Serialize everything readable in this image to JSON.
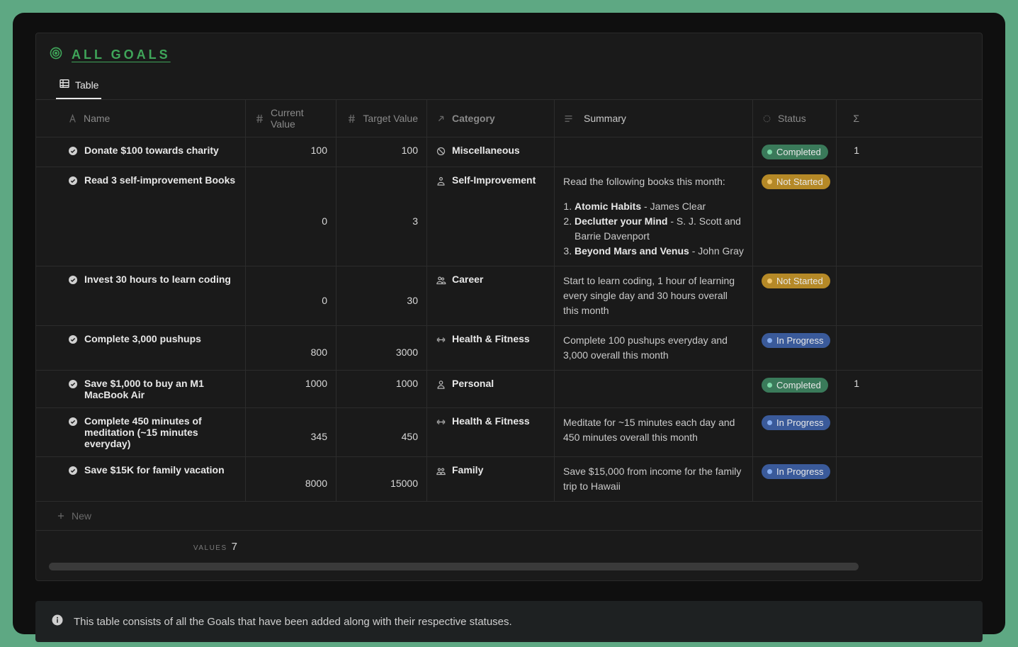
{
  "title": "ALL GOALS",
  "tab_label": "Table",
  "columns": {
    "name": "Name",
    "current": "Current Value",
    "target": "Target Value",
    "category": "Category",
    "summary": "Summary",
    "status": "Status",
    "sigma": "Σ"
  },
  "rows": [
    {
      "name": "Donate $100 towards charity",
      "current": "100",
      "target": "100",
      "category": "Miscellaneous",
      "category_icon": "ban",
      "summary_intro": "",
      "summary_items": [],
      "status": "Completed",
      "status_class": "completed",
      "sigma": "1"
    },
    {
      "name": "Read 3 self-improvement Books",
      "current": "0",
      "target": "3",
      "category": "Self-Improvement",
      "category_icon": "person-star",
      "summary_intro": "Read the following books this month:",
      "summary_items": [
        {
          "bold": "Atomic Habits",
          "rest": " - James Clear"
        },
        {
          "bold": "Declutter your Mind",
          "rest": " - S. J. Scott and Barrie Davenport"
        },
        {
          "bold": "Beyond Mars and Venus",
          "rest": " - John Gray"
        }
      ],
      "status": "Not Started",
      "status_class": "notstarted",
      "sigma": ""
    },
    {
      "name": "Invest 30 hours to learn coding",
      "current": "0",
      "target": "30",
      "category": "Career",
      "category_icon": "people",
      "summary_intro": "Start to learn coding, 1 hour of learning every single day and 30 hours overall this month",
      "summary_items": [],
      "status": "Not Started",
      "status_class": "notstarted",
      "sigma": ""
    },
    {
      "name": "Complete 3,000 pushups",
      "current": "800",
      "target": "3000",
      "category": "Health & Fitness",
      "category_icon": "dumbbell",
      "summary_intro": "Complete 100 pushups everyday and 3,000 overall this month",
      "summary_items": [],
      "status": "In Progress",
      "status_class": "inprogress",
      "sigma": ""
    },
    {
      "name": "Save $1,000 to buy an M1 MacBook Air",
      "current": "1000",
      "target": "1000",
      "category": "Personal",
      "category_icon": "person",
      "summary_intro": "",
      "summary_items": [],
      "status": "Completed",
      "status_class": "completed",
      "sigma": "1"
    },
    {
      "name": "Complete 450 minutes of meditation (~15 minutes everyday)",
      "current": "345",
      "target": "450",
      "category": "Health & Fitness",
      "category_icon": "dumbbell",
      "summary_intro": "Meditate for ~15 minutes each day and 450 minutes overall this month",
      "summary_items": [],
      "status": "In Progress",
      "status_class": "inprogress",
      "sigma": ""
    },
    {
      "name": "Save $15K for family vacation",
      "current": "8000",
      "target": "15000",
      "category": "Family",
      "category_icon": "group",
      "summary_intro": "Save $15,000 from income for the family trip to Hawaii",
      "summary_items": [],
      "status": "In Progress",
      "status_class": "inprogress",
      "sigma": ""
    }
  ],
  "new_label": "New",
  "values_label": "VALUES",
  "values_count": "7",
  "info_text": "This table consists of all the Goals that have been added along with their respective statuses."
}
